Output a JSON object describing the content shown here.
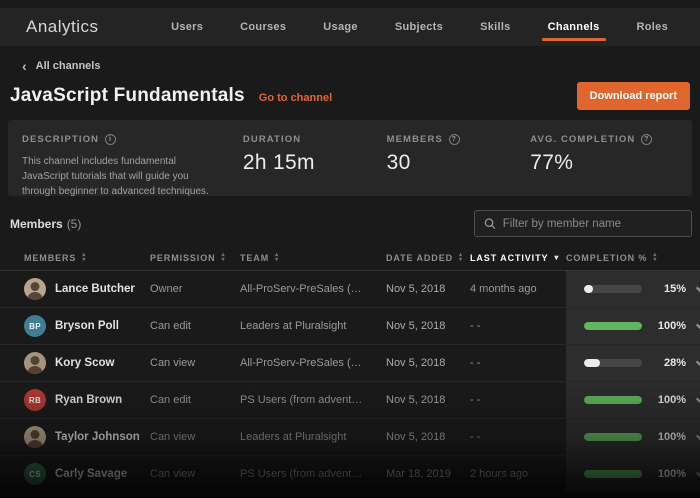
{
  "colors": {
    "accent": "#e0662e",
    "green": "#5fb75d",
    "white_bar": "#ececec"
  },
  "app": {
    "title": "Analytics"
  },
  "nav": {
    "items": [
      {
        "label": "Users",
        "active": false
      },
      {
        "label": "Courses",
        "active": false
      },
      {
        "label": "Usage",
        "active": false
      },
      {
        "label": "Subjects",
        "active": false
      },
      {
        "label": "Skills",
        "active": false
      },
      {
        "label": "Channels",
        "active": true
      },
      {
        "label": "Roles",
        "active": false
      }
    ]
  },
  "breadcrumb": {
    "back_icon": "chevron-left",
    "label": "All channels"
  },
  "header": {
    "title": "JavaScript Fundamentals",
    "go_to_channel_label": "Go to channel",
    "download_report_label": "Download report"
  },
  "summary": {
    "description": {
      "label": "DESCRIPTION",
      "info_icon": "info-icon",
      "text": "This channel includes fundamental JavaScript tutorials that will guide you through beginner to advanced techniques."
    },
    "duration": {
      "label": "DURATION",
      "value": "2h 15m"
    },
    "members": {
      "label": "MEMBERS",
      "help_icon": "question-icon",
      "value": "30"
    },
    "avg_completion": {
      "label": "AVG. COMPLETION",
      "help_icon": "question-icon",
      "value": "77%"
    }
  },
  "members_section": {
    "title": "Members",
    "count": "(5)",
    "filter": {
      "icon": "search-icon",
      "placeholder": "Filter by member name",
      "value": ""
    }
  },
  "table": {
    "columns": [
      {
        "label": "MEMBERS",
        "sort": "both",
        "active": false
      },
      {
        "label": "PERMISSION",
        "sort": "both",
        "active": false
      },
      {
        "label": "TEAM",
        "sort": "both",
        "active": false
      },
      {
        "label": "DATE ADDED",
        "sort": "both",
        "active": false
      },
      {
        "label": "LAST ACTIVITY",
        "sort": "desc",
        "active": true
      },
      {
        "label": "COMPLETION %",
        "sort": "both",
        "active": false
      }
    ],
    "rows": [
      {
        "name": "Lance Butcher",
        "avatar_type": "photo",
        "initials": "LB",
        "avatar_color": "#b9a58e",
        "permission": "Owner",
        "team": "All-ProServ-PreSales (…",
        "date_added": "Nov 5, 2018",
        "last_activity": "4 months ago",
        "completion_pct": 15,
        "completion_label": "15%",
        "bar_color": "#ececec"
      },
      {
        "name": "Bryson Poll",
        "avatar_type": "initials",
        "initials": "BP",
        "avatar_color": "#3e7f95",
        "permission": "Can edit",
        "team": "Leaders at Pluralsight",
        "date_added": "Nov 5, 2018",
        "last_activity": "- -",
        "completion_pct": 100,
        "completion_label": "100%",
        "bar_color": "#5fb75d"
      },
      {
        "name": "Kory Scow",
        "avatar_type": "photo",
        "initials": "KS",
        "avatar_color": "#a6937c",
        "permission": "Can view",
        "team": "All-ProServ-PreSales (…",
        "date_added": "Nov 5, 2018",
        "last_activity": "- -",
        "completion_pct": 28,
        "completion_label": "28%",
        "bar_color": "#ececec"
      },
      {
        "name": "Ryan Brown",
        "avatar_type": "initials",
        "initials": "RB",
        "avatar_color": "#b63a33",
        "permission": "Can edit",
        "team": "PS Users (from advent…",
        "date_added": "Nov 5, 2018",
        "last_activity": "- -",
        "completion_pct": 100,
        "completion_label": "100%",
        "bar_color": "#5fb75d"
      },
      {
        "name": "Taylor Johnson",
        "avatar_type": "photo",
        "initials": "TJ",
        "avatar_color": "#c0ab92",
        "permission": "Can view",
        "team": "Leaders at Pluralsight",
        "date_added": "Nov 5, 2018",
        "last_activity": "- -",
        "completion_pct": 100,
        "completion_label": "100%",
        "bar_color": "#5fb75d"
      },
      {
        "name": "Carly Savage",
        "avatar_type": "initials",
        "initials": "CS",
        "avatar_color": "#2f6e52",
        "permission": "Can view",
        "team": "PS Users (from advent…",
        "date_added": "Mar 18, 2019",
        "last_activity": "2 hours ago",
        "completion_pct": 100,
        "completion_label": "100%",
        "bar_color": "#5fb75d"
      }
    ]
  }
}
